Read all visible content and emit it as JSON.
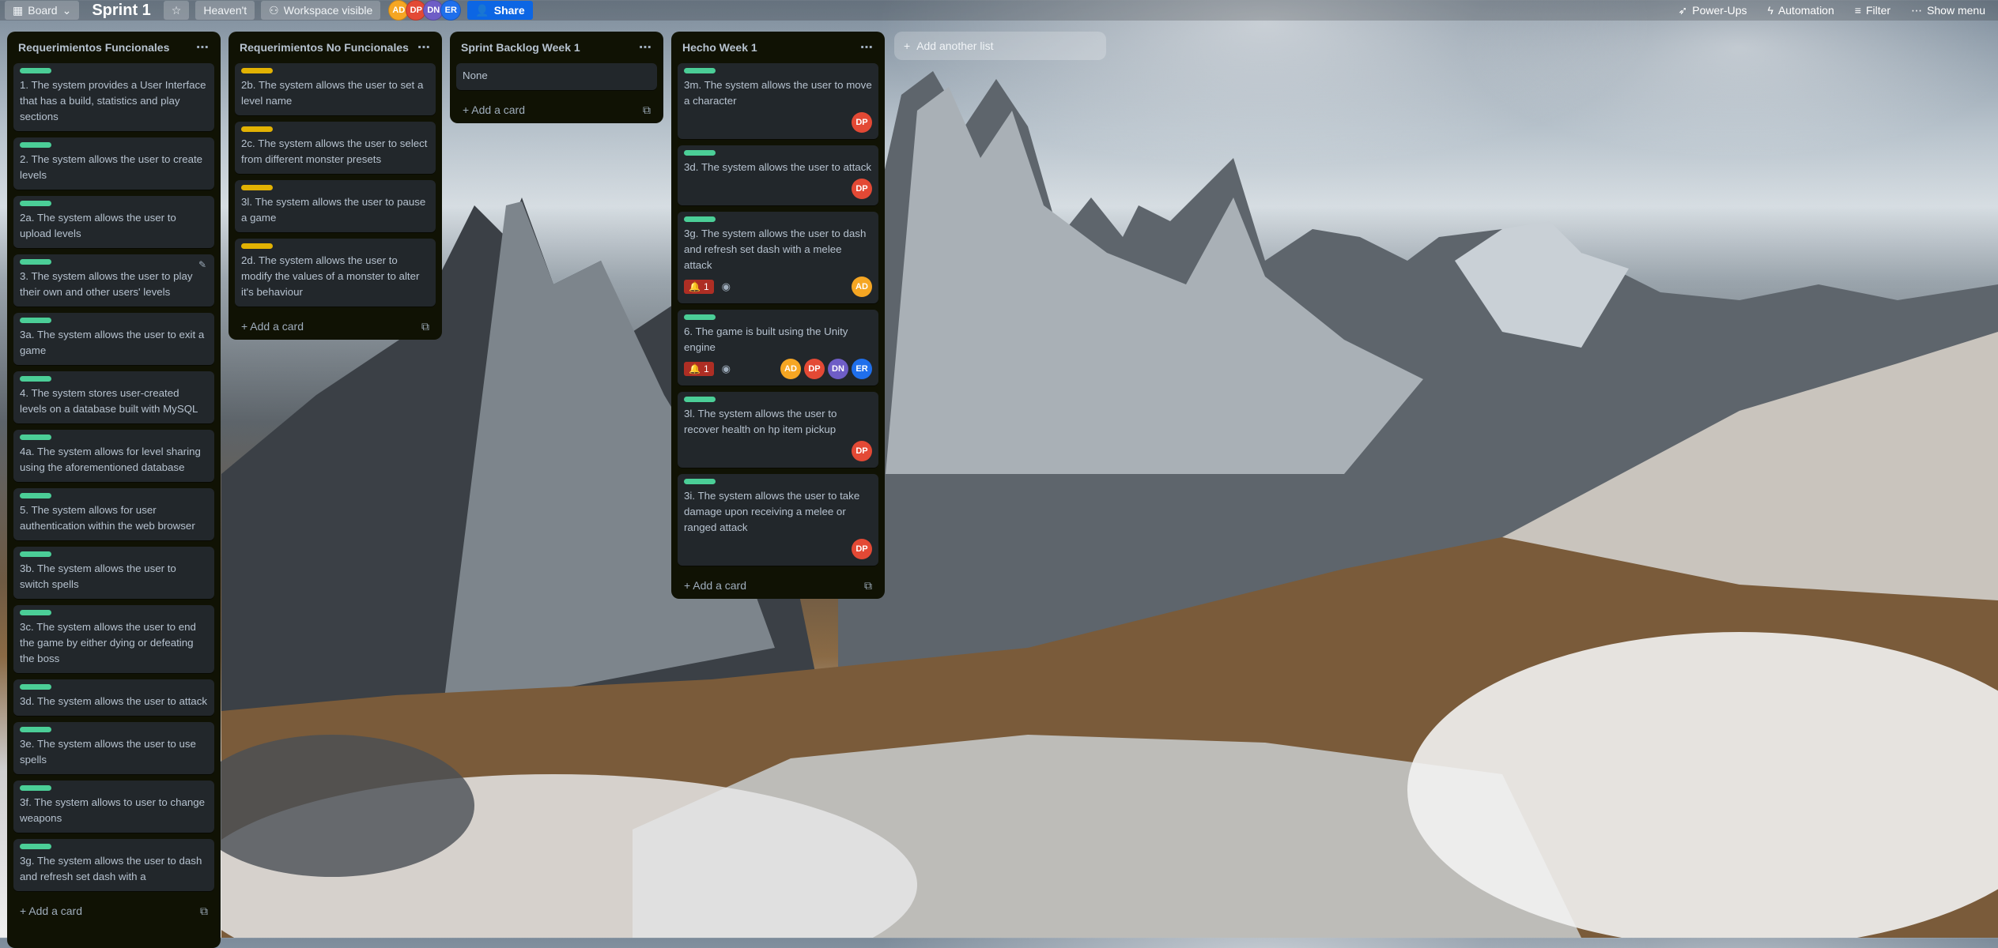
{
  "topbar": {
    "view_label": "Board",
    "board_title": "Sprint 1",
    "workspace": "Heaven't",
    "visibility": "Workspace visible",
    "members": [
      {
        "initials": "AD",
        "color": "#f5a623"
      },
      {
        "initials": "DP",
        "color": "#e34935"
      },
      {
        "initials": "DN",
        "color": "#6e5dc6"
      },
      {
        "initials": "ER",
        "color": "#1f6feb"
      }
    ],
    "share_label": "Share",
    "powerups_label": "Power-Ups",
    "automation_label": "Automation",
    "filter_label": "Filter",
    "menu_label": "Show menu"
  },
  "colors": {
    "green": "#4bce97",
    "yellow": "#e2b203",
    "list_bg": "#101204",
    "card_bg": "#22272b"
  },
  "lists": [
    {
      "title": "Requerimientos Funcionales",
      "cards": [
        {
          "label": "green",
          "text": "1. The system provides a User Interface that has a build, statistics and play sections"
        },
        {
          "label": "green",
          "text": "2. The system allows the user to create levels"
        },
        {
          "label": "green",
          "text": "2a. The system allows the user to upload levels"
        },
        {
          "label": "green",
          "text": "3. The system allows the user to play their own and other users' levels"
        },
        {
          "label": "green",
          "text": "3a. The system allows the user to exit a game"
        },
        {
          "label": "green",
          "text": "4. The system stores user-created levels on a database built with MySQL"
        },
        {
          "label": "green",
          "text": "4a. The system allows for level sharing using the aforementioned database"
        },
        {
          "label": "green",
          "text": "5. The system allows for user authentication within the web browser"
        },
        {
          "label": "green",
          "text": "3b. The system allows the user to switch spells"
        },
        {
          "label": "green",
          "text": "3c. The system allows the user to end the game by either dying or defeating the boss"
        },
        {
          "label": "green",
          "text": "3d. The system allows the user to attack"
        },
        {
          "label": "green",
          "text": "3e. The system allows the user to use spells"
        },
        {
          "label": "green",
          "text": "3f. The system allows to user to change weapons"
        },
        {
          "label": "green",
          "text": "3g. The system allows the user to dash and refresh set dash with a"
        }
      ],
      "add_card": "Add a card"
    },
    {
      "title": "Requerimientos No Funcionales",
      "cards": [
        {
          "label": "yellow",
          "text": "2b. The system allows the user to set a level name"
        },
        {
          "label": "yellow",
          "text": "2c. The system allows the user to select from different monster presets"
        },
        {
          "label": "yellow",
          "text": "3l. The system allows the user to pause a game"
        },
        {
          "label": "yellow",
          "text": "2d. The system allows the user to modify the values of a monster to alter it's behaviour"
        }
      ],
      "add_card": "Add a card"
    },
    {
      "title": "Sprint Backlog Week 1",
      "cards": [
        {
          "label": "",
          "text": "None"
        }
      ],
      "add_card": "Add a card"
    },
    {
      "title": "Hecho Week 1",
      "cards": [
        {
          "label": "green",
          "text": "3m. The system allows the user to move a character",
          "members": [
            "DP"
          ]
        },
        {
          "label": "green",
          "text": "3d. The system allows the user to attack",
          "members": [
            "DP"
          ]
        },
        {
          "label": "green",
          "text": "3g. The system allows the user to dash and refresh set dash with a melee attack",
          "notif": "1",
          "members": [
            "AD"
          ]
        },
        {
          "label": "green",
          "text": "6. The game is built using the Unity engine",
          "notif": "1",
          "members": [
            "AD",
            "DP",
            "DN",
            "ER"
          ]
        },
        {
          "label": "green",
          "text": "3l. The system allows the user to recover health on hp item pickup",
          "members": [
            "DP"
          ]
        },
        {
          "label": "green",
          "text": "3i. The system allows the user to take damage upon receiving a melee or ranged attack",
          "members": [
            "DP"
          ]
        }
      ],
      "add_card": "Add a card"
    }
  ],
  "add_list_label": "Add another list"
}
